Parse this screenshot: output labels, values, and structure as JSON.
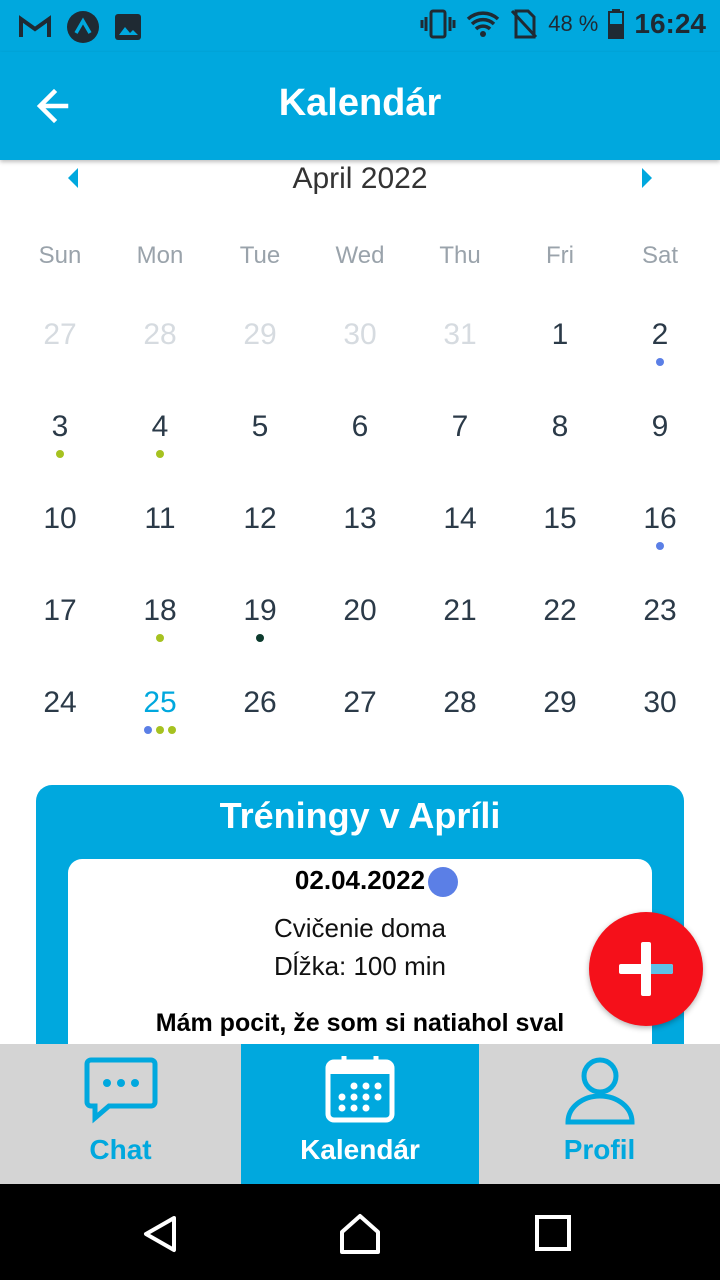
{
  "status_bar": {
    "battery": "48 %",
    "time": "16:24"
  },
  "app_bar": {
    "title": "Kalendár"
  },
  "calendar": {
    "month": "April 2022",
    "weekdays": [
      "Sun",
      "Mon",
      "Tue",
      "Wed",
      "Thu",
      "Fri",
      "Sat"
    ],
    "weeks": [
      [
        {
          "d": "27",
          "m": true
        },
        {
          "d": "28",
          "m": true
        },
        {
          "d": "29",
          "m": true
        },
        {
          "d": "30",
          "m": true
        },
        {
          "d": "31",
          "m": true
        },
        {
          "d": "1"
        },
        {
          "d": "2",
          "dots": [
            "#5b7fe6"
          ]
        }
      ],
      [
        {
          "d": "3",
          "dots": [
            "#a6c220"
          ]
        },
        {
          "d": "4",
          "dots": [
            "#a6c220"
          ]
        },
        {
          "d": "5"
        },
        {
          "d": "6"
        },
        {
          "d": "7"
        },
        {
          "d": "8"
        },
        {
          "d": "9"
        }
      ],
      [
        {
          "d": "10"
        },
        {
          "d": "11"
        },
        {
          "d": "12"
        },
        {
          "d": "13"
        },
        {
          "d": "14"
        },
        {
          "d": "15"
        },
        {
          "d": "16",
          "dots": [
            "#5b7fe6"
          ]
        }
      ],
      [
        {
          "d": "17"
        },
        {
          "d": "18",
          "dots": [
            "#a6c220"
          ]
        },
        {
          "d": "19",
          "dots": [
            "#0d3b2e"
          ]
        },
        {
          "d": "20"
        },
        {
          "d": "21"
        },
        {
          "d": "22"
        },
        {
          "d": "23"
        }
      ],
      [
        {
          "d": "24"
        },
        {
          "d": "25",
          "today": true,
          "dots": [
            "#5b7fe6",
            "#a6c220",
            "#a6c220"
          ]
        },
        {
          "d": "26"
        },
        {
          "d": "27"
        },
        {
          "d": "28"
        },
        {
          "d": "29"
        },
        {
          "d": "30"
        }
      ]
    ]
  },
  "trainings": {
    "title": "Tréningy v Apríli",
    "entry": {
      "date": "02.04.2022",
      "dot_color": "#5b7fe6",
      "type": "Cvičenie doma",
      "duration": "Dĺžka: 100 min",
      "note": "Mám pocit, že som si natiahol sval"
    }
  },
  "bottom_nav": {
    "chat": "Chat",
    "calendar": "Kalendár",
    "profile": "Profil"
  },
  "colors": {
    "accent": "#00a8de",
    "fab": "#f5101a"
  }
}
